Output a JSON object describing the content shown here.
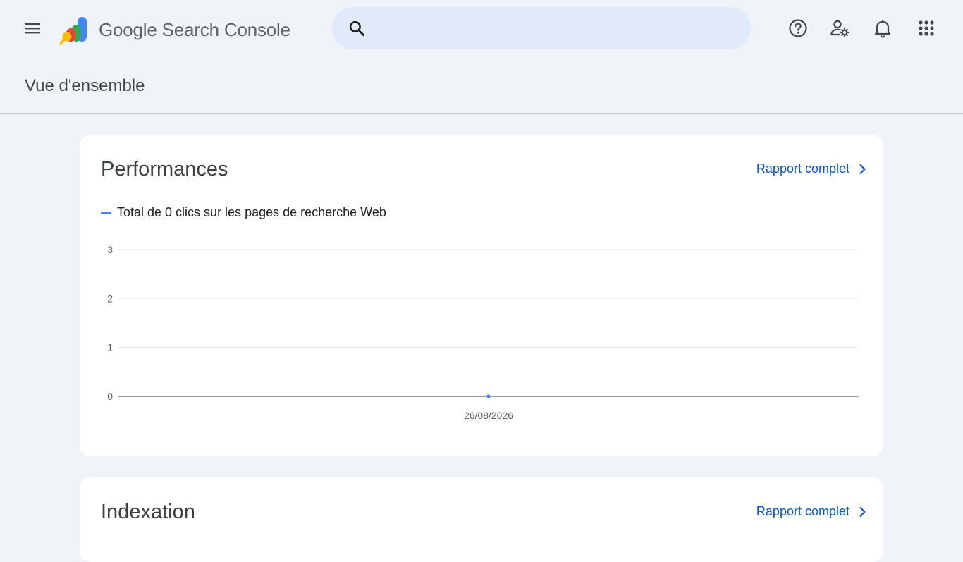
{
  "app": {
    "product_name": "Google Search Console"
  },
  "header": {
    "menu_icon": "hamburger-menu-icon",
    "search": {
      "placeholder": "",
      "value": ""
    },
    "icons": [
      "help-icon",
      "manage-users-settings-icon",
      "notifications-bell-icon",
      "apps-grid-icon"
    ]
  },
  "page": {
    "title": "Vue d'ensemble"
  },
  "performance": {
    "title": "Performances",
    "report_link": "Rapport complet",
    "legend": "Total de 0 clics sur les pages de recherche Web"
  },
  "indexing": {
    "title": "Indexation",
    "report_link": "Rapport complet"
  },
  "colors": {
    "background": "#f0f4f9",
    "search_bg": "#e1eafb",
    "link": "#0b57d0",
    "series": "#4285f4",
    "card": "#ffffff"
  },
  "chart_data": {
    "type": "line",
    "x": [
      "26/08/2026"
    ],
    "series": [
      {
        "values": [
          0
        ]
      }
    ],
    "ylim": [
      0,
      3
    ],
    "yticks": [
      0,
      1,
      2,
      3
    ],
    "grid": true,
    "legend": "top-left"
  }
}
